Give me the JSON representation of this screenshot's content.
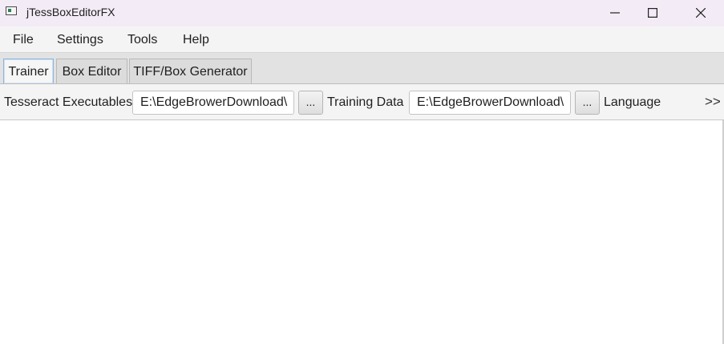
{
  "window": {
    "title": "jTessBoxEditorFX",
    "controls": {
      "minimize": "minimize-icon",
      "maximize": "maximize-icon",
      "close": "close-icon"
    }
  },
  "menu": {
    "items": [
      {
        "label": "File"
      },
      {
        "label": "Settings"
      },
      {
        "label": "Tools"
      },
      {
        "label": "Help"
      }
    ]
  },
  "tabs": {
    "items": [
      {
        "label": "Trainer",
        "active": true
      },
      {
        "label": "Box Editor",
        "active": false
      },
      {
        "label": "TIFF/Box Generator",
        "active": false
      }
    ]
  },
  "toolbar": {
    "tesseract_label": "Tesseract Executables",
    "tesseract_value": "E:\\EdgeBrowerDownload\\",
    "tesseract_browse": "...",
    "training_label": "Training Data",
    "training_value": "E:\\EdgeBrowerDownload\\",
    "training_browse": "...",
    "language_label": "Language",
    "overflow_label": ">>"
  },
  "colors": {
    "titlebar_bg": "#f3ebf5",
    "active_tab_border": "#8fb3dc"
  }
}
